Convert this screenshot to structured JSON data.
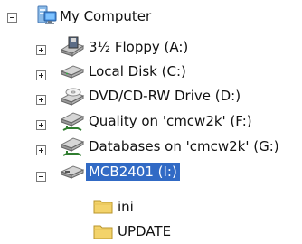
{
  "tree": {
    "root": {
      "label": "My Computer",
      "icon": "my-computer-icon",
      "expanded": true
    },
    "drives": [
      {
        "label": "3½ Floppy (A:)",
        "icon": "floppy-drive-icon",
        "expanded": false
      },
      {
        "label": "Local Disk (C:)",
        "icon": "hard-disk-icon",
        "expanded": false
      },
      {
        "label": "DVD/CD-RW Drive (D:)",
        "icon": "optical-drive-icon",
        "expanded": false
      },
      {
        "label": "Quality on 'cmcw2k' (F:)",
        "icon": "network-drive-icon",
        "expanded": false
      },
      {
        "label": "Databases on 'cmcw2k' (G:)",
        "icon": "network-drive-icon",
        "expanded": false
      },
      {
        "label": "MCB2401 (I:)",
        "icon": "removable-drive-icon",
        "expanded": true,
        "selected": true
      }
    ],
    "folders": [
      {
        "label": "ini",
        "icon": "folder-icon"
      },
      {
        "label": "UPDATE",
        "icon": "folder-icon"
      }
    ]
  },
  "colors": {
    "selection": "#316ac5",
    "selection_text": "#ffffff",
    "folder": "#f3d36b"
  }
}
